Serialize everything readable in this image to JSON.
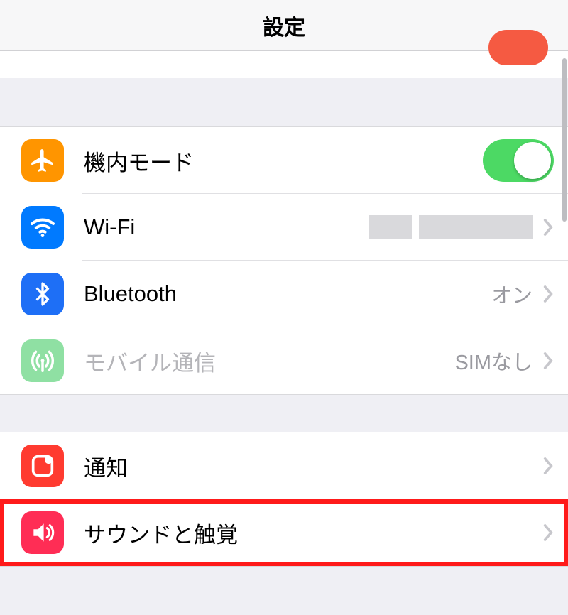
{
  "header": {
    "title": "設定"
  },
  "group1": {
    "airplane": {
      "label": "機内モード",
      "on": true
    },
    "wifi": {
      "label": "Wi-Fi"
    },
    "bluetooth": {
      "label": "Bluetooth",
      "value": "オン"
    },
    "cellular": {
      "label": "モバイル通信",
      "value": "SIMなし"
    }
  },
  "group2": {
    "notifications": {
      "label": "通知"
    },
    "sounds": {
      "label": "サウンドと触覚"
    }
  }
}
